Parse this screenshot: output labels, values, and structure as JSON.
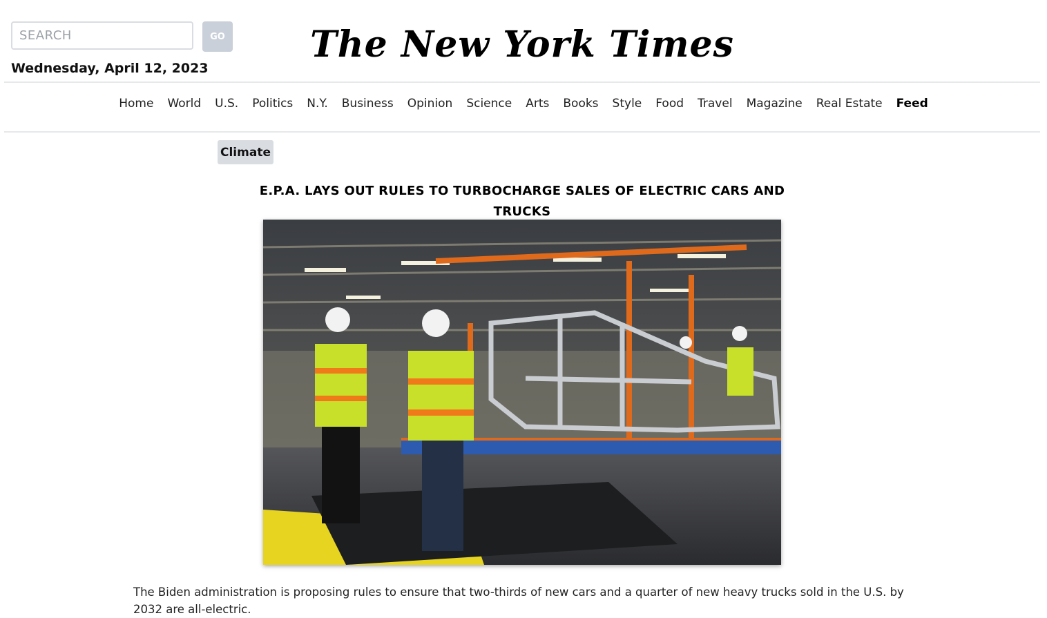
{
  "search": {
    "placeholder": "SEARCH",
    "button_label": "GO"
  },
  "date": "Wednesday, April 12, 2023",
  "masthead": "The New York Times",
  "nav": {
    "items": [
      {
        "label": "Home"
      },
      {
        "label": "World"
      },
      {
        "label": "U.S."
      },
      {
        "label": "Politics"
      },
      {
        "label": "N.Y."
      },
      {
        "label": "Business"
      },
      {
        "label": "Opinion"
      },
      {
        "label": "Science"
      },
      {
        "label": "Arts"
      },
      {
        "label": "Books"
      },
      {
        "label": "Style"
      },
      {
        "label": "Food"
      },
      {
        "label": "Travel"
      },
      {
        "label": "Magazine"
      },
      {
        "label": "Real Estate"
      },
      {
        "label": "Feed",
        "active": true
      }
    ]
  },
  "article": {
    "section": "Climate",
    "headline": "E.P.A. Lays Out Rules to Turbocharge Sales of Electric Cars and Trucks",
    "summary": "The Biden administration is proposing rules to ensure that two-thirds of new cars and a quarter of new heavy trucks sold in the U.S. by 2032 are all-electric."
  },
  "colors": {
    "go_button": "#c9d0d9",
    "section_tag": "#d9dde2",
    "vest": "#c8e02a",
    "vest_stripe": "#f07a1a",
    "rig_orange": "#e06a1c"
  }
}
